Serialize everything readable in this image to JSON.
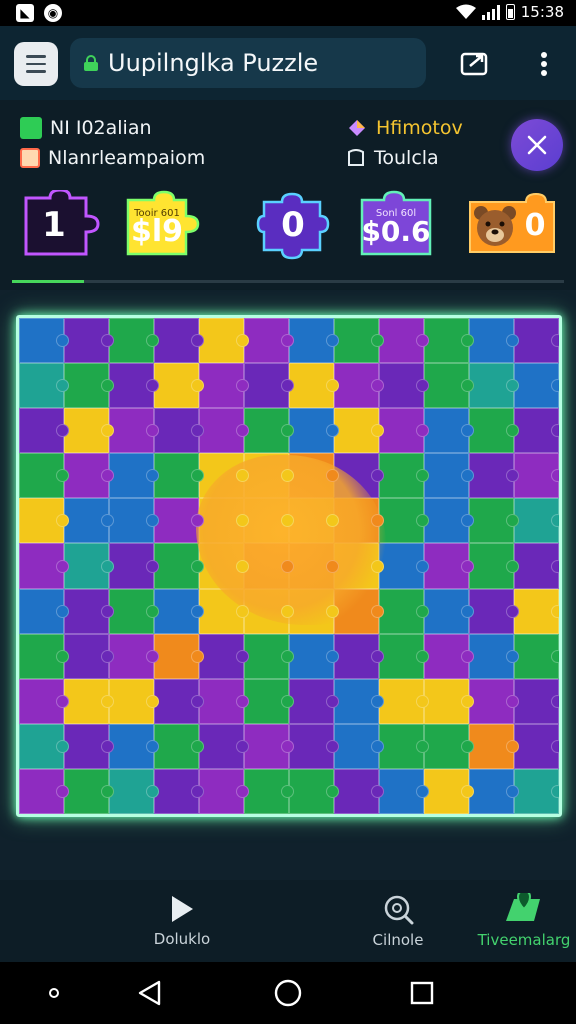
{
  "status_bar": {
    "time": "15:38",
    "icons": [
      "app-notification-icon",
      "brand-icon",
      "wifi-icon",
      "signal-icon",
      "battery-icon"
    ]
  },
  "app_bar": {
    "title": "Uupilnglka Puzzle",
    "icons": [
      "menu-icon",
      "lock-icon",
      "share-icon",
      "more-vert-icon"
    ]
  },
  "info": {
    "left_top": {
      "text": "NI I02alian",
      "color": "#2ecc55"
    },
    "left_bottom": {
      "text": "Nlanrleampaiom",
      "color": "#ff6a4a"
    },
    "right_top": {
      "text": "Hfimotov",
      "color": "#f4c430"
    },
    "right_bottom": {
      "text": "Toulcla"
    }
  },
  "counters": [
    {
      "name": "moves",
      "value": "1",
      "caption": "",
      "color": "#c156ff",
      "style": "outline"
    },
    {
      "name": "cost",
      "value": "$l9",
      "caption": "Tooir 601",
      "color": "#ffe431",
      "style": "filled"
    },
    {
      "name": "score",
      "value": "0",
      "caption": "",
      "color": "#6a3ad8",
      "style": "outline"
    },
    {
      "name": "balance",
      "value": "$0.6",
      "caption": "Sonl 60l",
      "color": "#7d46d8",
      "style": "filled"
    },
    {
      "name": "bear",
      "value": "0",
      "caption": "",
      "color": "#ff9a1f",
      "style": "filled"
    }
  ],
  "progress": {
    "value": 0.13,
    "color": "#46d65a"
  },
  "board": {
    "cols": 12,
    "rows": 11,
    "palette": {
      "g": "#1fa84b",
      "p": "#6a28b8",
      "y": "#f3c71a",
      "o": "#f08a1c",
      "b": "#1f72c6",
      "t": "#1fa394",
      "v": "#8e2cc0",
      "r": "#c9233a",
      "k": "#2a8f3c"
    },
    "grid": [
      "bpgpyvbgvgbp",
      "tgpyvpyvpgtb",
      "pyvpvgbyvbgp",
      "gvbgyyopgbpv",
      "ybbvyyyogbgt",
      "vtpgyooybvgp",
      "bpgbyyyogbpy",
      "gpvopgbpgvbg",
      "vyypvgpbyyvp",
      "tpbgpvpbggop",
      "vgtpvggpbybt"
    ]
  },
  "bottom_nav": [
    {
      "label": "Doluklo",
      "icon": "play-icon",
      "active": false
    },
    {
      "label": "Cilnole",
      "icon": "search-target-icon",
      "active": false
    },
    {
      "label": "Tiveemalarg",
      "icon": "map-pin-icon",
      "active": true
    }
  ],
  "system_nav": [
    "recent-dot-icon",
    "back-icon",
    "home-icon",
    "overview-icon"
  ]
}
